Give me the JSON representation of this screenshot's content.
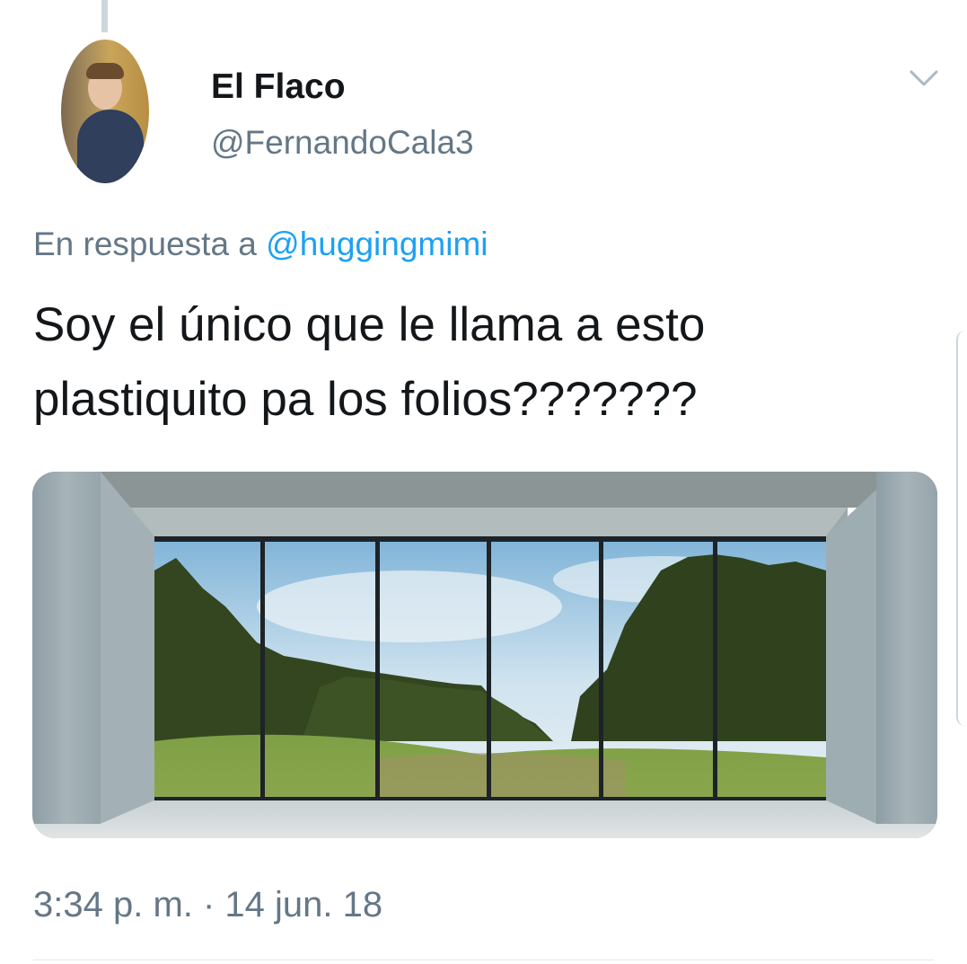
{
  "tweet": {
    "display_name": "El Flaco",
    "handle": "@FernandoCala3",
    "reply_prefix": "En respuesta a",
    "reply_mention": "@huggingmimi",
    "text_line_1": "Soy el único que le llama a esto",
    "text_line_2": "plastiquito pa los folios???????",
    "timestamp": "3:34 p. m. · 14 jun. 18"
  },
  "icons": {
    "more": "chevron-down-icon"
  },
  "colors": {
    "text": "#14171a",
    "secondary": "#657786",
    "link": "#1da1f2",
    "divider": "#e1e8ed"
  }
}
